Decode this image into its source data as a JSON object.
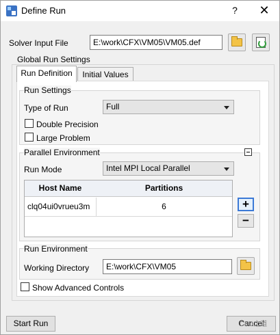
{
  "window": {
    "title": "Define Run",
    "help": "?",
    "close": "✕"
  },
  "solver_input": {
    "label": "Solver Input File",
    "value": "E:\\work\\CFX\\VM05\\VM05.def"
  },
  "global_run_settings": {
    "title": "Global Run Settings",
    "tabs": [
      {
        "label": "Run Definition",
        "active": true
      },
      {
        "label": "Initial Values",
        "active": false
      }
    ]
  },
  "run_settings": {
    "title": "Run Settings",
    "type_of_run_label": "Type of Run",
    "type_of_run_value": "Full",
    "double_precision_label": "Double Precision",
    "double_precision_checked": false,
    "large_problem_label": "Large Problem",
    "large_problem_checked": false
  },
  "parallel_env": {
    "title": "Parallel Environment",
    "run_mode_label": "Run Mode",
    "run_mode_value": "Intel MPI Local Parallel",
    "table": {
      "headers": [
        "Host Name",
        "Partitions"
      ],
      "rows": [
        [
          "clq04ui0vrueu3m",
          "6"
        ]
      ]
    },
    "add_label": "+",
    "remove_label": "−"
  },
  "run_env": {
    "title": "Run Environment",
    "working_dir_label": "Working Directory",
    "working_dir_value": "E:\\work\\CFX\\VM05"
  },
  "advanced": {
    "label": "Show Advanced Controls",
    "checked": false
  },
  "footer": {
    "start_run": "Start Run",
    "cancel": "Cancel",
    "watermark": "CFD之道"
  }
}
